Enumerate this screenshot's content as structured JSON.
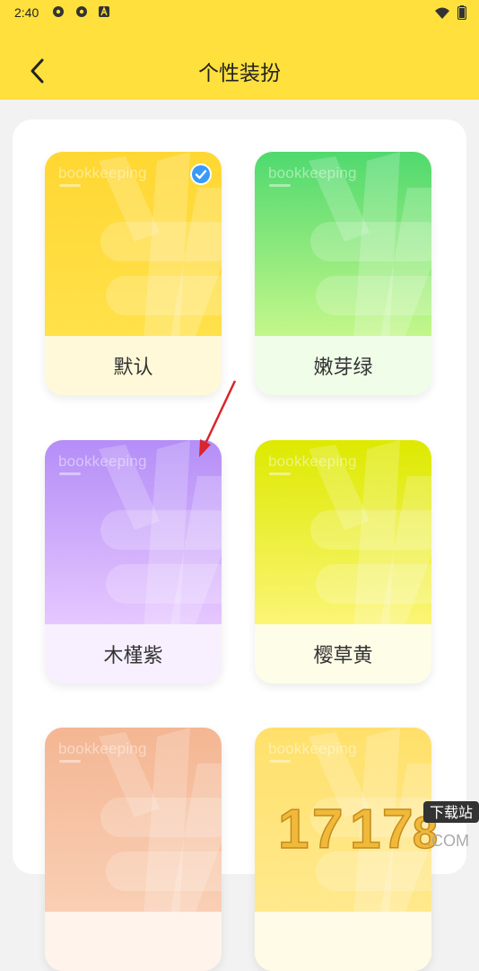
{
  "status_bar": {
    "time": "2:40"
  },
  "header": {
    "title": "个性装扮"
  },
  "card_brand_text": "bookkeeping",
  "themes": [
    {
      "name": "默认",
      "selected": true,
      "grad_top": "#ffd733",
      "grad_bottom": "#ffe14a",
      "label_bg": "#fff9d9"
    },
    {
      "name": "嫩芽绿",
      "selected": false,
      "grad_top": "#4fd96e",
      "grad_bottom": "#c4f78a",
      "label_bg": "#f0fde8"
    },
    {
      "name": "木槿紫",
      "selected": false,
      "grad_top": "#b48ef7",
      "grad_bottom": "#e6c7ff",
      "label_bg": "#f8f0ff"
    },
    {
      "name": "樱草黄",
      "selected": false,
      "grad_top": "#dde900",
      "grad_bottom": "#fbf576",
      "label_bg": "#fefde8"
    },
    {
      "name": "",
      "selected": false,
      "grad_top": "#f4b693",
      "grad_bottom": "#f9cfb4",
      "label_bg": "#fff3ec"
    },
    {
      "name": "",
      "selected": false,
      "grad_top": "#ffe06b",
      "grad_bottom": "#ffe98d",
      "label_bg": "#fffbe6"
    }
  ],
  "watermark": {
    "site": "下载站"
  },
  "colors": {
    "header_bg": "#ffe03d",
    "check_blue": "#3a9af5",
    "arrow_red": "#d8262d"
  }
}
